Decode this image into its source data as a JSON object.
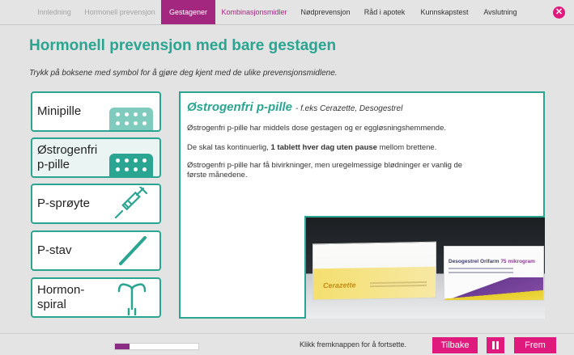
{
  "nav": {
    "items": [
      {
        "label": "Innledning",
        "state": "done"
      },
      {
        "label": "Hormonell prevensjon",
        "state": "done"
      },
      {
        "label": "Gestagener",
        "state": "active"
      },
      {
        "label": "Kombinasjonsmidler",
        "state": "sub"
      },
      {
        "label": "Nødprevensjon",
        "state": "normal"
      },
      {
        "label": "Råd i apotek",
        "state": "normal"
      },
      {
        "label": "Kunnskapstest",
        "state": "normal"
      },
      {
        "label": "Avslutning",
        "state": "normal"
      }
    ],
    "close_label": "✕"
  },
  "page": {
    "title": "Hormonell prevensjon med bare gestagen",
    "instruction": "Trykk på boksene med symbol for å gjøre deg kjent med de ulike prevensjonsmidlene."
  },
  "methods": [
    {
      "label": "Minipille",
      "icon": "pill-pack-icon",
      "selected": false
    },
    {
      "label": "Østrogenfri\np-pille",
      "icon": "pill-pack-icon",
      "selected": true
    },
    {
      "label": "P-sprøyte",
      "icon": "syringe-icon",
      "selected": false
    },
    {
      "label": "P-stav",
      "icon": "implant-rod-icon",
      "selected": false
    },
    {
      "label": "Hormon-\nspiral",
      "icon": "iud-icon",
      "selected": false
    }
  ],
  "detail": {
    "title": "Østrogenfri p-pille",
    "subtitle": "- f.eks Cerazette, Desogestrel",
    "para1": "Østrogenfri p-pille har middels dose gestagen og er eggløsningshemmende.",
    "para2_before": "De skal tas kontinuerlig, ",
    "para2_bold": "1 tablett hver dag uten pause",
    "para2_after": " mellom brettene.",
    "para3": "Østrogenfri p-pille har få bivirkninger, men uregelmessige blødninger er vanlig de første månedene.",
    "photo": {
      "box1_brand": "Cerazette",
      "box2_brand": "Desogestrel Orifarm",
      "box2_strength": "75 mikrogram"
    }
  },
  "footer": {
    "progress": 0.17,
    "hint": "Klikk fremknappen for å fortsette.",
    "back_label": "Tilbake",
    "next_label": "Frem"
  },
  "colors": {
    "accent": "#2aa591",
    "nav_active": "#a3277f",
    "button": "#e0197c"
  }
}
